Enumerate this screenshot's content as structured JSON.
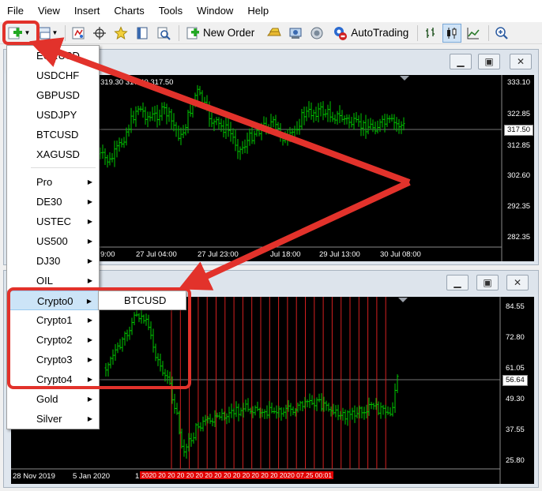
{
  "menubar": [
    "File",
    "View",
    "Insert",
    "Charts",
    "Tools",
    "Window",
    "Help"
  ],
  "toolbar": {
    "new_order": "New Order",
    "autotrading": "AutoTrading",
    "icons": [
      "new-chart-icon",
      "profiles-icon",
      "market-watch-icon",
      "crosshair-icon",
      "favorites-icon",
      "data-window-icon",
      "strategy-tester-icon",
      "new-order-icon",
      "gold-bars-icon",
      "trader-icon",
      "signals-icon",
      "autotrading-icon",
      "bar-chart-icon",
      "candles-icon",
      "line-chart-icon",
      "zoom-in-icon"
    ]
  },
  "menu": {
    "items": [
      {
        "label": "EURUSD",
        "sub": false
      },
      {
        "label": "USDCHF",
        "sub": false
      },
      {
        "label": "GBPUSD",
        "sub": false
      },
      {
        "label": "USDJPY",
        "sub": false
      },
      {
        "label": "BTCUSD",
        "sub": false
      },
      {
        "label": "XAGUSD",
        "sub": false
      },
      {
        "label": "Pro",
        "sub": true
      },
      {
        "label": "DE30",
        "sub": true
      },
      {
        "label": "USTEC",
        "sub": true
      },
      {
        "label": "US500",
        "sub": true
      },
      {
        "label": "DJ30",
        "sub": true
      },
      {
        "label": "OIL",
        "sub": true
      },
      {
        "label": "Crypto0",
        "sub": true,
        "highlighted": true
      },
      {
        "label": "Crypto1",
        "sub": true
      },
      {
        "label": "Crypto2",
        "sub": true
      },
      {
        "label": "Crypto3",
        "sub": true
      },
      {
        "label": "Crypto4",
        "sub": true
      },
      {
        "label": "Gold",
        "sub": true
      },
      {
        "label": "Silver",
        "sub": true
      }
    ],
    "submenu": [
      "BTCUSD"
    ]
  },
  "chart1": {
    "header": "319.30 317.40 317.50",
    "price_labels": [
      "333.10",
      "322.85",
      "312.85",
      "302.60",
      "292.35",
      "282.35"
    ],
    "current_price": "317.50",
    "time_labels": [
      "9:00",
      "27 Jul 04:00",
      "27 Jul 23:00",
      "Jul 18:00",
      "29 Jul 13:00",
      "30 Jul 08:00"
    ]
  },
  "chart2": {
    "price_labels": [
      "84.55",
      "72.80",
      "61.05",
      "49.30",
      "37.55",
      "25.80"
    ],
    "current_price": "56.64",
    "time_labels": [
      "28 Nov 2019",
      "5 Jan 2020",
      "1"
    ],
    "highlight_time": "2020  20  20  20  20  20  20  20  20  20  20  20  20  20  2020  07.25  00:01"
  },
  "colors": {
    "candle": "#00c800",
    "chart_bg": "#000000",
    "annotation": "#e2322b",
    "vline": "#d42020"
  }
}
